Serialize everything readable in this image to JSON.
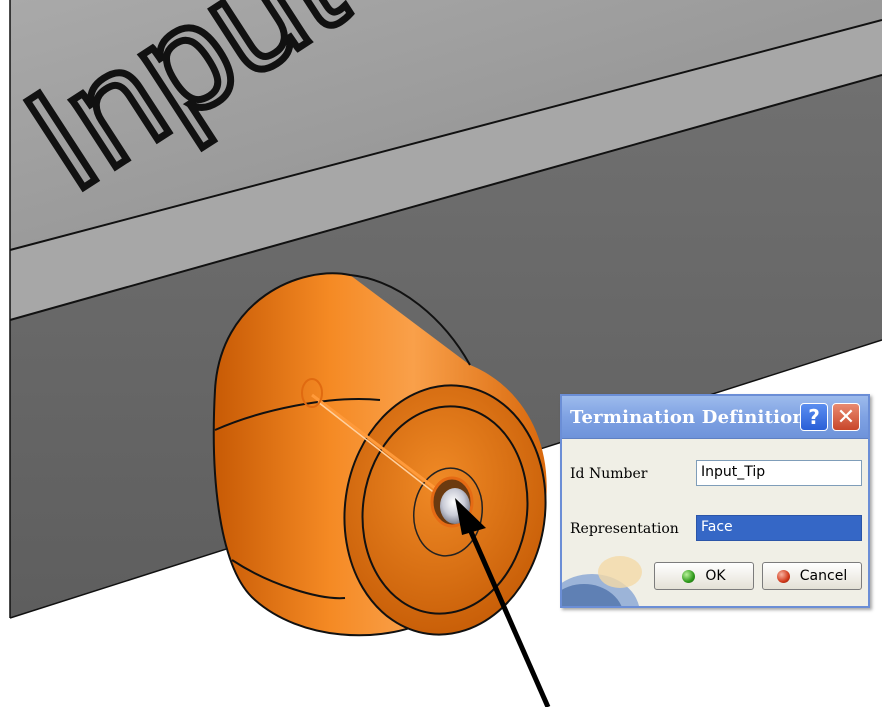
{
  "viewport": {
    "embossed_text": "Input"
  },
  "dialog": {
    "title": "Termination Definition",
    "help_glyph": "?",
    "close_glyph": "✕",
    "fields": [
      {
        "label": "Id Number",
        "value": "Input_Tip"
      },
      {
        "label": "Representation",
        "value": "Face"
      }
    ],
    "ok_label": "OK",
    "cancel_label": "Cancel"
  },
  "colors": {
    "part_orange": "#f07a12",
    "box_face_gray": "#6a6a6a",
    "title_bar": "#7fa2e3",
    "selected_field": "#3567c6"
  },
  "icons": [
    "help-icon",
    "close-icon",
    "ok-icon",
    "cancel-icon",
    "pointer-arrow-icon"
  ]
}
